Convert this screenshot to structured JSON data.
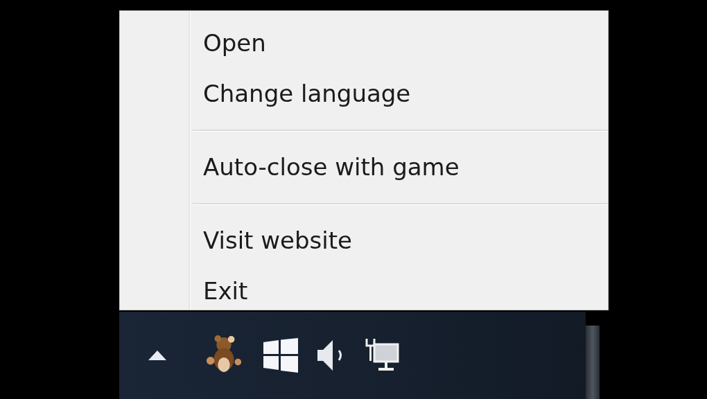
{
  "context_menu": {
    "items": [
      {
        "kind": "item",
        "label": "Open"
      },
      {
        "kind": "item",
        "label": "Change language"
      },
      {
        "kind": "separator"
      },
      {
        "kind": "item",
        "label": "Auto-close with game"
      },
      {
        "kind": "separator"
      },
      {
        "kind": "item",
        "label": "Visit website"
      },
      {
        "kind": "item",
        "label": "Exit"
      }
    ]
  }
}
